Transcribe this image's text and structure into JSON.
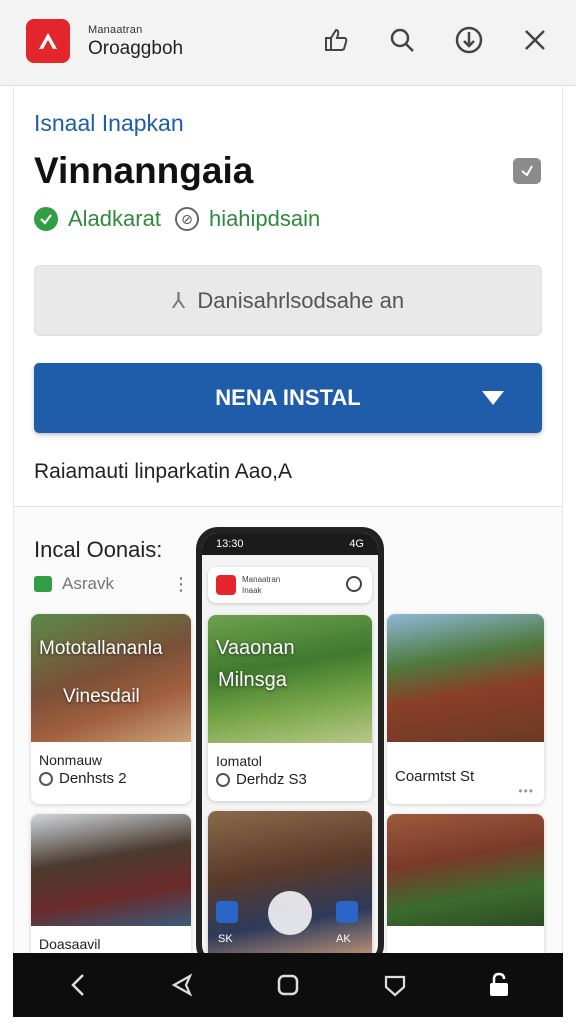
{
  "header": {
    "app_subtitle": "Manaatran",
    "app_name": "Oroaggboh",
    "icons": [
      "thumb-icon",
      "search-icon",
      "download-icon",
      "close-icon"
    ]
  },
  "details": {
    "breadcrumb": "Isnaal Inapkan",
    "title": "Vinnanngaia",
    "status_primary": "Aladkarat",
    "status_secondary": "hiahipdsain",
    "secondary_button": "Danisahrlsodsahe an",
    "install_button": "NENA INSTAL",
    "note": "Raiamauti linparkatin Aao,A"
  },
  "gallery": {
    "title": "Incal Oonais:",
    "tag": "Asravk",
    "tiles": [
      {
        "overlay1": "Mototallananla",
        "overlay2": "Vinesdail",
        "caption": "Nonmauw",
        "subcaption": "Denhsts 2"
      },
      {
        "overlay1": "Vaaonan",
        "overlay2": "Milnsga",
        "caption": "Iomatol",
        "subcaption": "Derhdz S3"
      },
      {
        "overlay1": "",
        "overlay2": "",
        "caption": "",
        "subcaption": "Coarmtst St"
      },
      {
        "caption": "Doasaavil"
      },
      {
        "caption": ""
      },
      {
        "caption": ""
      }
    ],
    "phone": {
      "time": "13:30",
      "signal": "4G",
      "sub1": "Manaatran",
      "sub2": "Inaak",
      "bottom_left": "SK",
      "bottom_right": "AK"
    }
  },
  "navbar": {
    "buttons": [
      "back-icon",
      "send-icon",
      "home-icon",
      "shield-icon",
      "lock-icon"
    ]
  },
  "colors": {
    "brand_red": "#e4262c",
    "install_blue": "#1f5dab",
    "status_green": "#2f8a3e",
    "breadcrumb_blue": "#1d5ea8"
  }
}
